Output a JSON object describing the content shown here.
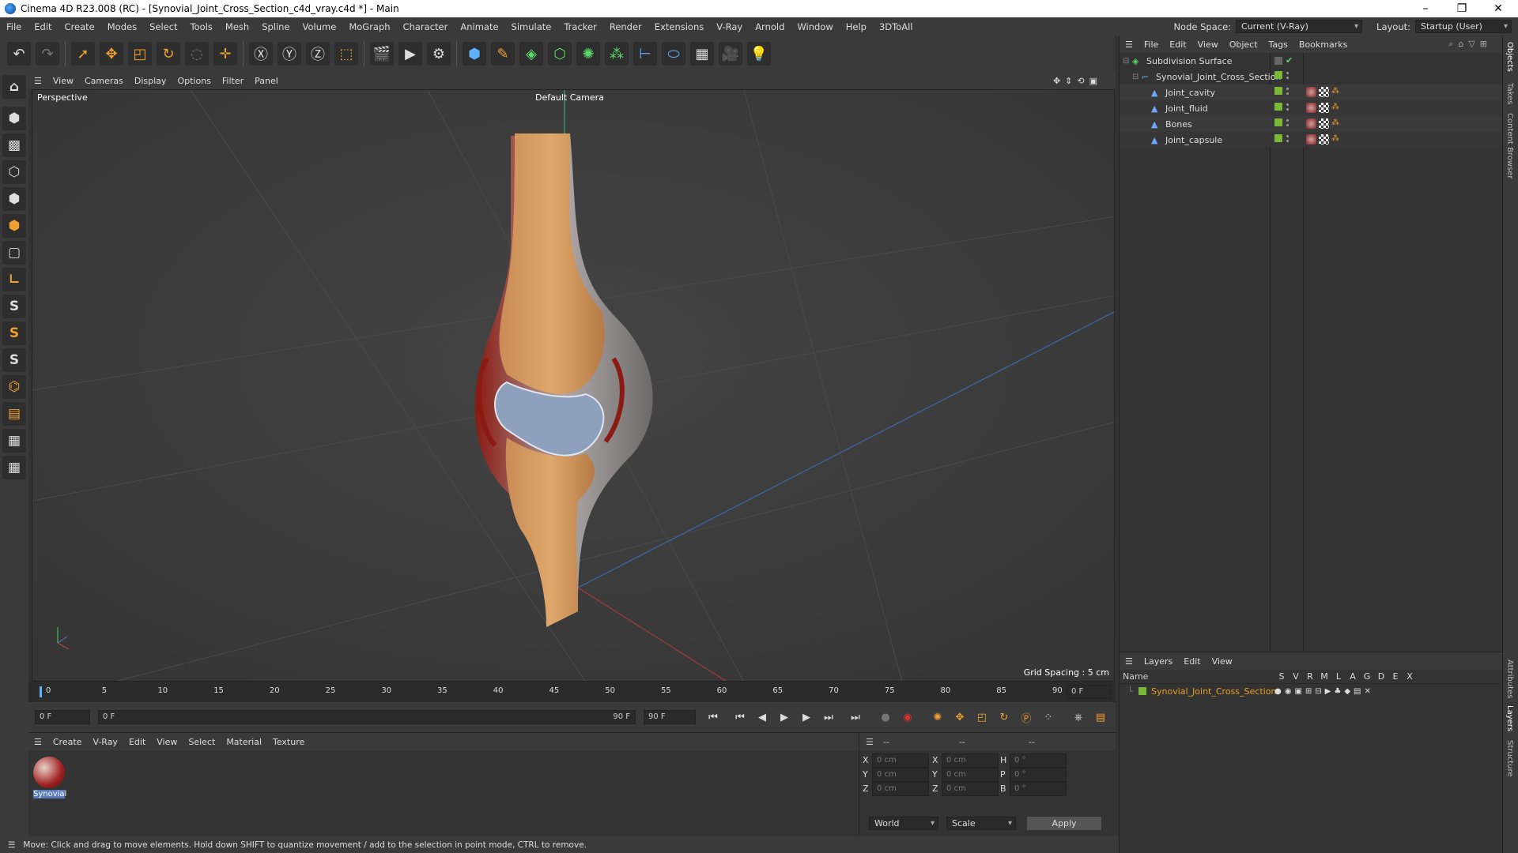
{
  "titlebar": {
    "title": "Cinema 4D R23.008 (RC) - [Synovial_Joint_Cross_Section_c4d_vray.c4d *] - Main",
    "minimize": "–",
    "maximize": "❐",
    "close": "✕"
  },
  "menu": {
    "items": [
      "File",
      "Edit",
      "Create",
      "Modes",
      "Select",
      "Tools",
      "Mesh",
      "Spline",
      "Volume",
      "MoGraph",
      "Character",
      "Animate",
      "Simulate",
      "Tracker",
      "Render",
      "Extensions",
      "V-Ray",
      "Arnold",
      "Window",
      "Help",
      "3DToAll"
    ],
    "node_space_label": "Node Space:",
    "node_space_value": "Current (V-Ray)",
    "layout_label": "Layout:",
    "layout_value": "Startup (User)"
  },
  "viewport": {
    "menu": [
      "View",
      "Cameras",
      "Display",
      "Options",
      "Filter",
      "Panel"
    ],
    "view_name": "Perspective",
    "camera": "Default Camera",
    "grid_spacing": "Grid Spacing : 5 cm"
  },
  "timeline": {
    "ticks": [
      "0",
      "5",
      "10",
      "15",
      "20",
      "25",
      "30",
      "35",
      "40",
      "45",
      "50",
      "55",
      "60",
      "65",
      "70",
      "75",
      "80",
      "85",
      "90"
    ],
    "current_frame": "0 F"
  },
  "playback": {
    "start": "0 F",
    "range_start": "0 F",
    "range_end": "90 F",
    "end": "90 F"
  },
  "material_panel": {
    "menu": [
      "Create",
      "V-Ray",
      "Edit",
      "View",
      "Select",
      "Material",
      "Texture"
    ],
    "material_name": "Synovial"
  },
  "coords": {
    "headers": [
      "--",
      "--",
      "--"
    ],
    "rows": [
      {
        "a": "X",
        "av": "0 cm",
        "b": "X",
        "bv": "0 cm",
        "c": "H",
        "cv": "0 °"
      },
      {
        "a": "Y",
        "av": "0 cm",
        "b": "Y",
        "bv": "0 cm",
        "c": "P",
        "cv": "0 °"
      },
      {
        "a": "Z",
        "av": "0 cm",
        "b": "Z",
        "bv": "0 cm",
        "c": "B",
        "cv": "0 °"
      }
    ],
    "space": "World",
    "mode": "Scale",
    "apply": "Apply"
  },
  "status": {
    "text": "Move: Click and drag to move elements. Hold down SHIFT to quantize movement / add to the selection in point mode, CTRL to remove."
  },
  "objects": {
    "menu": [
      "File",
      "Edit",
      "View",
      "Object",
      "Tags",
      "Bookmarks"
    ],
    "items": [
      {
        "name": "Subdivision Surface",
        "indent": 0
      },
      {
        "name": "Synovial_Joint_Cross_Section",
        "indent": 1
      },
      {
        "name": "Joint_cavity",
        "indent": 2
      },
      {
        "name": "Joint_fluid",
        "indent": 2
      },
      {
        "name": "Bones",
        "indent": 2
      },
      {
        "name": "Joint_capsule",
        "indent": 2
      }
    ]
  },
  "layers": {
    "menu": [
      "Layers",
      "Edit",
      "View"
    ],
    "name_header": "Name",
    "flags": [
      "S",
      "V",
      "R",
      "M",
      "L",
      "A",
      "G",
      "D",
      "E",
      "X"
    ],
    "layer_name": "Synovial_Joint_Cross_Section"
  },
  "sidetabs": [
    "Objects",
    "Takes",
    "Content Browser",
    "Attributes",
    "Layers",
    "Structure"
  ],
  "colors": {
    "accent": "#f0a030",
    "layer_text": "#e8a020",
    "selection": "#5a5a5a"
  }
}
